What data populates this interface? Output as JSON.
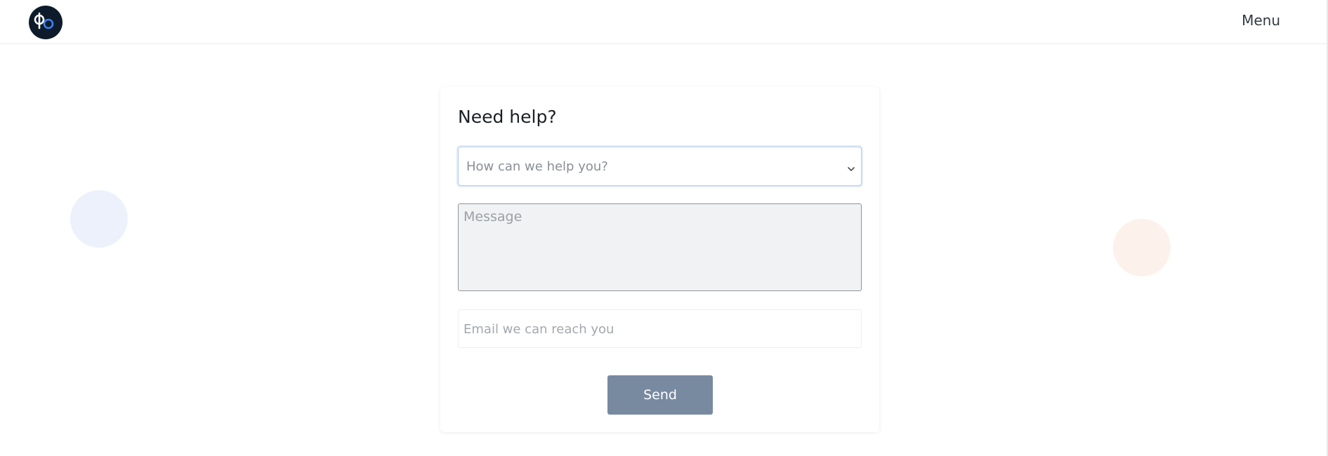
{
  "header": {
    "logo_alt": "bo",
    "menu_label": "Menu"
  },
  "form": {
    "title": "Need help?",
    "topic_select": {
      "value": "How can we help you?"
    },
    "message": {
      "placeholder": "Message"
    },
    "email": {
      "placeholder": "Email we can reach you"
    },
    "send_label": "Send"
  },
  "colors": {
    "logo_bg": "#0d1b2a",
    "logo_accent": "#3b82f6",
    "send_button_bg": "#788aa0",
    "circle_left": "#ecf1fc",
    "circle_right": "#fdf1eb"
  },
  "icons": {
    "logo": "bo-logo-icon",
    "select_arrow": "chevron-down-icon"
  }
}
